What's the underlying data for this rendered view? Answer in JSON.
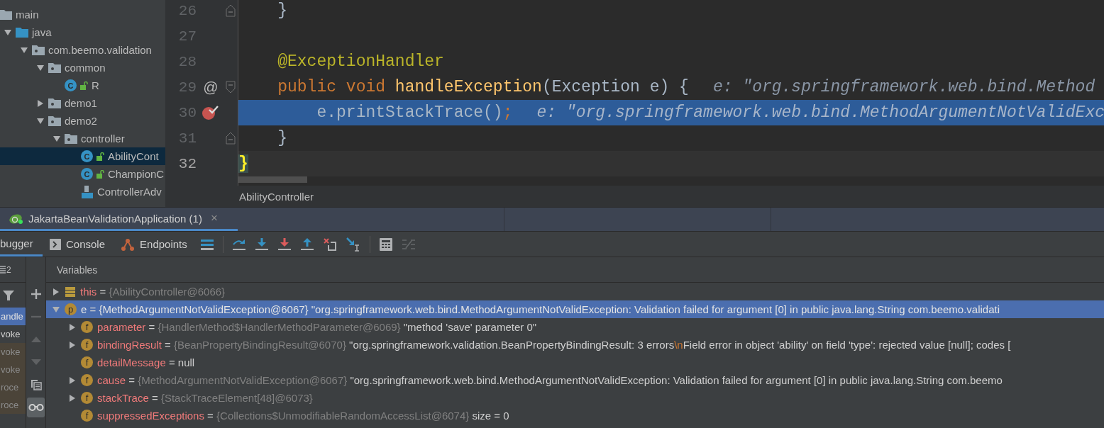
{
  "project_tree": [
    {
      "label": "main",
      "kind": "folder",
      "children": [
        {
          "label": "java",
          "kind": "source-folder",
          "expanded": true,
          "selected": false,
          "children": [
            {
              "label": "com.beemo.validation",
              "kind": "package",
              "expanded": true,
              "selected": false,
              "children": [
                {
                  "label": "common",
                  "kind": "package",
                  "expanded": true,
                  "selected": false,
                  "children": [
                    {
                      "label": "R",
                      "kind": "class",
                      "badge": "C",
                      "selected": false
                    }
                  ]
                },
                {
                  "label": "demo1",
                  "kind": "package",
                  "expanded": false,
                  "selected": false
                },
                {
                  "label": "demo2",
                  "kind": "package",
                  "expanded": true,
                  "selected": false,
                  "children": [
                    {
                      "label": "controller",
                      "kind": "package",
                      "expanded": true,
                      "selected": false,
                      "children": [
                        {
                          "label": "AbilityCont",
                          "kind": "class",
                          "badge": "C",
                          "selected": true
                        },
                        {
                          "label": "ChampionC",
                          "kind": "class",
                          "badge": "C",
                          "selected": false
                        },
                        {
                          "label": "ControllerAdv",
                          "kind": "java-file",
                          "selected": false
                        }
                      ]
                    }
                  ]
                }
              ]
            }
          ]
        }
      ],
      "selected": false
    }
  ],
  "editor": {
    "lines": [
      {
        "number": "26",
        "selected": false,
        "current": false,
        "fold": {
          "kind": "end"
        },
        "tokens": [
          {
            "text": "    }",
            "kind": "plain"
          }
        ]
      },
      {
        "number": "27",
        "selected": false,
        "current": false
      },
      {
        "number": "28",
        "selected": false,
        "current": false,
        "tokens": [
          {
            "text": "    @ExceptionHandler",
            "kind": "annotation"
          }
        ]
      },
      {
        "number": "29",
        "selected": false,
        "current": false,
        "gutter": {
          "kind": "override",
          "text": "@"
        },
        "fold": {
          "kind": "start"
        },
        "tokens": [
          {
            "text": "    public void ",
            "kind": "keyword"
          },
          {
            "text": "handleException",
            "kind": "method"
          },
          {
            "text": "(Exception e) {",
            "kind": "plain"
          }
        ],
        "inlay": "e: \"org.springframework.web.bind.Method"
      },
      {
        "number": "30",
        "gutter": {
          "kind": "breakpoint"
        },
        "selected": true,
        "current": false,
        "tokens": [
          {
            "text": "        e.printStackTrace()",
            "kind": "plain"
          },
          {
            "text": ";",
            "kind": "keyword"
          }
        ],
        "inlay": "e: \"org.springframework.web.bind.MethodArgumentNotValidExc"
      },
      {
        "number": "31",
        "selected": false,
        "current": false,
        "fold": {
          "kind": "end"
        },
        "tokens": [
          {
            "text": "    }",
            "kind": "plain"
          }
        ]
      },
      {
        "number": "32",
        "selected": false,
        "current": true,
        "tokens": [
          {
            "text": "}",
            "kind": "brace-match"
          }
        ]
      }
    ],
    "breadcrumb": "AbilityController"
  },
  "debug": {
    "session_tab": {
      "label": "JakartaBeanValidationApplication (1)",
      "close": "×"
    },
    "tabs": [
      {
        "label": "bugger",
        "kind": "debugger",
        "selected": true
      },
      {
        "label": "Console",
        "kind": "console",
        "selected": false
      },
      {
        "label": "Endpoints",
        "kind": "endpoints",
        "selected": false
      }
    ],
    "toolbar": [
      {
        "kind": "layout",
        "disabled": false
      },
      {
        "kind": "step-over",
        "disabled": false
      },
      {
        "kind": "step-into",
        "disabled": false
      },
      {
        "kind": "force-step-into",
        "disabled": false
      },
      {
        "kind": "step-out",
        "disabled": false
      },
      {
        "kind": "drop-frame",
        "disabled": false
      },
      {
        "kind": "run-to-cursor",
        "disabled": false
      },
      {
        "kind": "evaluate",
        "disabled": false
      },
      {
        "kind": "trace",
        "disabled": true
      }
    ],
    "frames_header": "2",
    "frames": [
      {
        "label": "andle",
        "library": false,
        "selected": true
      },
      {
        "label": "voke",
        "library": false,
        "selected": false
      },
      {
        "label": "voke",
        "library": true,
        "selected": false
      },
      {
        "label": "voke",
        "library": true,
        "selected": false
      },
      {
        "label": "roce",
        "library": true,
        "selected": false
      },
      {
        "label": "roce",
        "library": true,
        "selected": false
      }
    ],
    "side_tools": [
      {
        "kind": "add",
        "disabled": false,
        "selected": false
      },
      {
        "kind": "remove",
        "disabled": true,
        "selected": false
      },
      {
        "kind": "up",
        "disabled": true,
        "selected": false
      },
      {
        "kind": "down",
        "disabled": true,
        "selected": false
      },
      {
        "kind": "copy",
        "disabled": false,
        "selected": false
      },
      {
        "kind": "watches",
        "disabled": false,
        "selected": true
      }
    ],
    "variables_title": "Variables",
    "variables": [
      {
        "kind": "this",
        "name": "this",
        "equals": "=",
        "type": "{AbilityController@6066}",
        "expanded": false,
        "selected": false
      },
      {
        "kind": "parameter",
        "badge": "p",
        "name": "e",
        "equals": "=",
        "type": "{MethodArgumentNotValidException@6067}",
        "value": [
          {
            "text": "\"org.springframework.web.bind.MethodArgumentNotValidException: Validation failed for argument [0] in public java.lang.String com.beemo.validati",
            "kind": "string"
          }
        ],
        "expanded": true,
        "selected": true,
        "children": [
          {
            "kind": "field",
            "badge": "f",
            "name": "parameter",
            "equals": "=",
            "type": "{HandlerMethod$HandlerMethodParameter@6069}",
            "value": [
              {
                "text": "\"method 'save' parameter 0\"",
                "kind": "string"
              }
            ],
            "expanded": false,
            "selected": false
          },
          {
            "kind": "field",
            "badge": "f",
            "name": "bindingResult",
            "equals": "=",
            "type": "{BeanPropertyBindingResult@6070}",
            "value": [
              {
                "text": "\"org.springframework.validation.BeanPropertyBindingResult: 3 errors",
                "kind": "string"
              },
              {
                "text": "\\n",
                "kind": "escape"
              },
              {
                "text": "Field error in object 'ability' on field 'type': rejected value [null]; codes [",
                "kind": "string"
              }
            ],
            "expanded": false,
            "selected": false
          },
          {
            "kind": "field",
            "badge": "f",
            "name": "detailMessage",
            "equals": "=",
            "value": [
              {
                "text": "null",
                "kind": "string"
              }
            ],
            "selected": false
          },
          {
            "kind": "field",
            "badge": "f",
            "name": "cause",
            "equals": "=",
            "type": "{MethodArgumentNotValidException@6067}",
            "value": [
              {
                "text": "\"org.springframework.web.bind.MethodArgumentNotValidException: Validation failed for argument [0] in public java.lang.String com.beemo",
                "kind": "string"
              }
            ],
            "expanded": false,
            "selected": false
          },
          {
            "kind": "field",
            "badge": "f",
            "name": "stackTrace",
            "equals": "=",
            "type": "{StackTraceElement[48]@6073}",
            "expanded": false,
            "selected": false
          },
          {
            "kind": "field",
            "badge": "f",
            "name": "suppressedExceptions",
            "equals": "=",
            "type": "{Collections$UnmodifiableRandomAccessList@6074}",
            "value": [
              {
                "text": "size = 0",
                "kind": "string"
              }
            ],
            "selected": false
          }
        ]
      }
    ]
  }
}
